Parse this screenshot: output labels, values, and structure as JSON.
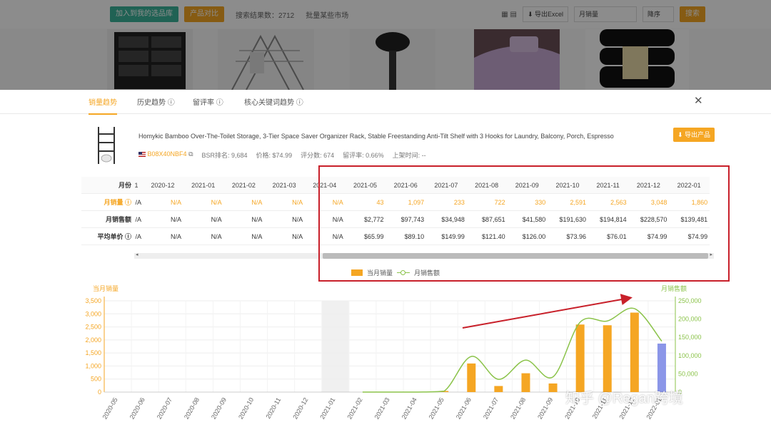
{
  "background": {
    "buttons": [
      {
        "label": "加入到我的选品库",
        "color": "#3bb39a"
      },
      {
        "label": "产品对比",
        "color": "#f5a623"
      }
    ],
    "search_count": "搜索结果数：2712",
    "batch_label": "批量某些市场",
    "export_excel": "导出Excel",
    "sort_select": "月销量",
    "order_select": "降序",
    "search_button": "搜索"
  },
  "tabs": [
    {
      "label": "销量趋势",
      "active": true
    },
    {
      "label": "历史趋势 ⓘ",
      "active": false
    },
    {
      "label": "留评率 ⓘ",
      "active": false
    },
    {
      "label": "核心关键词趋势 ⓘ",
      "active": false
    }
  ],
  "product": {
    "title": "Homykic Bamboo Over-The-Toilet Storage, 3-Tier Space Saver Organizer Rack, Stable Freestanding Anti-Tilt Shelf with 3 Hooks for Laundry, Balcony, Porch, Espresso",
    "asin": "B08X40NBF4",
    "bsr": "BSR排名: 9,684",
    "price": "价格: $74.99",
    "rating": "评分数: 674",
    "review_rate": "留评率: 0.66%",
    "launch": "上架时间: --",
    "export_label": "导出产品"
  },
  "table": {
    "row_labels": [
      "月份",
      "月销量 ⓘ",
      "月销售额",
      "平均单价 ⓘ"
    ],
    "columns": [
      {
        "month": "1",
        "units": "/A",
        "revenue": "/A",
        "avg": "/A"
      },
      {
        "month": "2020-12",
        "units": "N/A",
        "revenue": "N/A",
        "avg": "N/A"
      },
      {
        "month": "2021-01",
        "units": "N/A",
        "revenue": "N/A",
        "avg": "N/A"
      },
      {
        "month": "2021-02",
        "units": "N/A",
        "revenue": "N/A",
        "avg": "N/A"
      },
      {
        "month": "2021-03",
        "units": "N/A",
        "revenue": "N/A",
        "avg": "N/A"
      },
      {
        "month": "2021-04",
        "units": "N/A",
        "revenue": "N/A",
        "avg": "N/A"
      },
      {
        "month": "2021-05",
        "units": "43",
        "revenue": "$2,772",
        "avg": "$65.99"
      },
      {
        "month": "2021-06",
        "units": "1,097",
        "revenue": "$97,743",
        "avg": "$89.10"
      },
      {
        "month": "2021-07",
        "units": "233",
        "revenue": "$34,948",
        "avg": "$149.99"
      },
      {
        "month": "2021-08",
        "units": "722",
        "revenue": "$87,651",
        "avg": "$121.40"
      },
      {
        "month": "2021-09",
        "units": "330",
        "revenue": "$41,580",
        "avg": "$126.00"
      },
      {
        "month": "2021-10",
        "units": "2,591",
        "revenue": "$191,630",
        "avg": "$73.96"
      },
      {
        "month": "2021-11",
        "units": "2,563",
        "revenue": "$194,814",
        "avg": "$76.01"
      },
      {
        "month": "2021-12",
        "units": "3,048",
        "revenue": "$228,570",
        "avg": "$74.99"
      },
      {
        "month": "2022-01",
        "units": "1,860",
        "revenue": "$139,481",
        "avg": "$74.99"
      }
    ]
  },
  "legend": {
    "units": "当月销量",
    "revenue": "月销售额"
  },
  "colors": {
    "accent": "#f5a623",
    "bar": "#f5a623",
    "bar_current": "#8b96e8",
    "line": "#8bc34a",
    "highlight_box": "#c8202a"
  },
  "watermark": "知乎 @Regan跨境",
  "chart_data": {
    "type": "bar",
    "ylabel": "当月销量",
    "y2label": "月销售额",
    "ylim": [
      0,
      3500
    ],
    "y2lim": [
      0,
      250000
    ],
    "yticks": [
      "0",
      "500",
      "1,000",
      "1,500",
      "2,000",
      "2,500",
      "3,000",
      "3,500"
    ],
    "y2ticks": [
      "0",
      "50,000",
      "100,000",
      "150,000",
      "200,000",
      "250,000"
    ],
    "categories": [
      "2020-05",
      "2020-06",
      "2020-07",
      "2020-08",
      "2020-09",
      "2020-10",
      "2020-11",
      "2020-12",
      "2021-01",
      "2021-02",
      "2021-03",
      "2021-04",
      "2021-05",
      "2021-06",
      "2021-07",
      "2021-08",
      "2021-09",
      "2021-10",
      "2021-11",
      "2021-12",
      "2022-01"
    ],
    "series": [
      {
        "name": "当月销量",
        "kind": "bar",
        "values": [
          0,
          0,
          0,
          0,
          0,
          0,
          0,
          0,
          0,
          0,
          0,
          0,
          43,
          1097,
          233,
          722,
          330,
          2591,
          2563,
          3048,
          1860
        ]
      },
      {
        "name": "月销售额",
        "kind": "line",
        "axis": "right",
        "values": [
          0,
          0,
          0,
          0,
          0,
          0,
          0,
          0,
          0,
          0,
          0,
          0,
          2772,
          97743,
          34948,
          87651,
          41580,
          191630,
          194814,
          228570,
          139481
        ]
      }
    ],
    "highlight_category": "2021-01",
    "grid": true
  }
}
